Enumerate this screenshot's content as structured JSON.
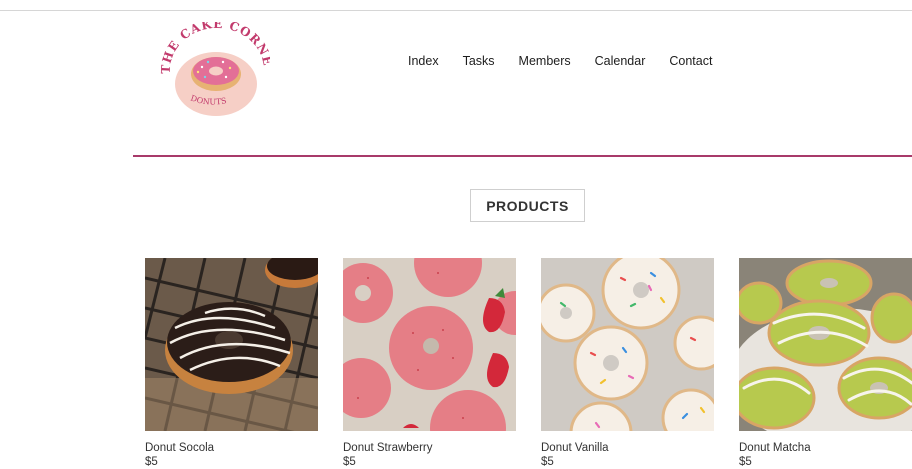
{
  "brand": {
    "logo_text_top": "THE CAKE CORNER",
    "logo_text_bottom": "DONUTS",
    "accent": "#a83a6a"
  },
  "nav": {
    "items": [
      "Index",
      "Tasks",
      "Members",
      "Calendar",
      "Contact"
    ]
  },
  "section": {
    "title": "PRODUCTS"
  },
  "products": [
    {
      "name": "Donut Socola",
      "price": "$5",
      "image": "chocolate-donut"
    },
    {
      "name": "Donut Strawberry",
      "price": "$5",
      "image": "strawberry-donut"
    },
    {
      "name": "Donut Vanilla",
      "price": "$5",
      "image": "vanilla-sprinkle-donut"
    },
    {
      "name": "Donut Matcha",
      "price": "$5",
      "image": "matcha-donut"
    }
  ]
}
